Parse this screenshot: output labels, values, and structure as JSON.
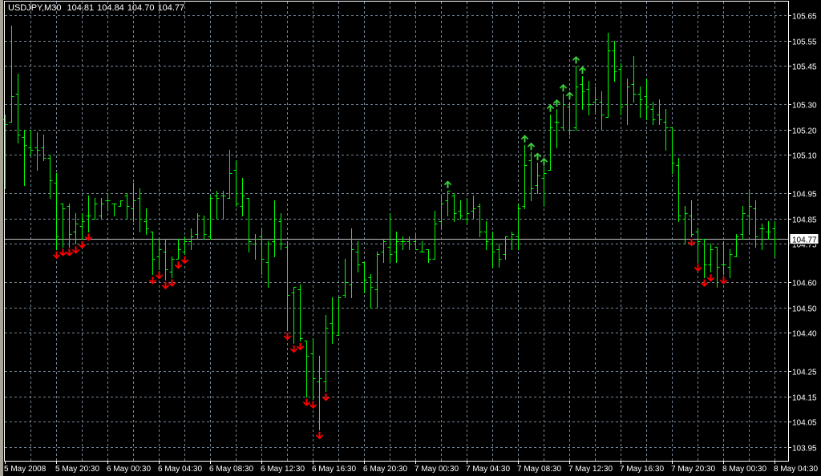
{
  "header": {
    "symbol": "USDJPY,M30",
    "open": "104.81",
    "high": "104.84",
    "low": "104.70",
    "close": "104.77"
  },
  "current_price_label": "104.77",
  "colors": {
    "background": "#000000",
    "bar": "#00ff00",
    "grid": "#778899",
    "down_arrow": "#ff0000",
    "up_arrow": "#3cd03c",
    "price_line": "#c0c0c0"
  },
  "chart_data": {
    "type": "ohlc",
    "title": "USDJPY,M30",
    "timeframe": "M30",
    "ylim": [
      103.95,
      105.65
    ],
    "grid": true,
    "current_price": 104.77,
    "y_ticks": [
      "105.65",
      "105.55",
      "105.45",
      "105.30",
      "105.20",
      "105.10",
      "104.95",
      "104.85",
      "104.75",
      "104.60",
      "104.50",
      "104.40",
      "104.25",
      "104.15",
      "104.05",
      "103.95"
    ],
    "x_tick_labels": [
      {
        "bar": 0,
        "label": "5 May 2008"
      },
      {
        "bar": 8,
        "label": "5 May 20:30"
      },
      {
        "bar": 16,
        "label": "6 May 00:30"
      },
      {
        "bar": 24,
        "label": "6 May 04:30"
      },
      {
        "bar": 32,
        "label": "6 May 08:30"
      },
      {
        "bar": 40,
        "label": "6 May 12:30"
      },
      {
        "bar": 48,
        "label": "6 May 16:30"
      },
      {
        "bar": 56,
        "label": "6 May 20:30"
      },
      {
        "bar": 64,
        "label": "7 May 00:30"
      },
      {
        "bar": 72,
        "label": "7 May 04:30"
      },
      {
        "bar": 80,
        "label": "7 May 08:30"
      },
      {
        "bar": 88,
        "label": "7 May 12:30"
      },
      {
        "bar": 96,
        "label": "7 May 16:30"
      },
      {
        "bar": 104,
        "label": "7 May 20:30"
      },
      {
        "bar": 112,
        "label": "8 May 00:30"
      },
      {
        "bar": 120,
        "label": "8 May 04:30"
      }
    ],
    "ohlc": [
      [
        105.24,
        105.26,
        104.97,
        105.22
      ],
      [
        105.23,
        105.61,
        105.23,
        105.33
      ],
      [
        105.34,
        105.42,
        105.15,
        105.18
      ],
      [
        105.17,
        105.2,
        104.98,
        105.14
      ],
      [
        105.13,
        105.2,
        105.1,
        105.12
      ],
      [
        105.13,
        105.19,
        105.04,
        105.12
      ],
      [
        105.13,
        105.18,
        105.08,
        105.09
      ],
      [
        105.09,
        105.1,
        104.93,
        105.0
      ],
      [
        104.99,
        105.03,
        104.73,
        104.78
      ],
      [
        104.91,
        104.91,
        104.74,
        104.89
      ],
      [
        104.9,
        104.91,
        104.74,
        104.79
      ],
      [
        104.8,
        104.87,
        104.75,
        104.83
      ],
      [
        104.82,
        104.87,
        104.77,
        104.84
      ],
      [
        104.86,
        104.94,
        104.8,
        104.86
      ],
      [
        104.85,
        104.93,
        104.85,
        104.91
      ],
      [
        104.86,
        104.93,
        104.85,
        104.91
      ],
      [
        104.92,
        104.95,
        104.88,
        104.92
      ],
      [
        104.91,
        104.91,
        104.86,
        104.91
      ],
      [
        104.9,
        104.92,
        104.9,
        104.92
      ],
      [
        104.94,
        104.95,
        104.85,
        104.9
      ],
      [
        104.89,
        104.99,
        104.84,
        104.92
      ],
      [
        104.93,
        104.97,
        104.8,
        104.85
      ],
      [
        104.84,
        104.89,
        104.79,
        104.81
      ],
      [
        104.8,
        104.8,
        104.63,
        104.69
      ],
      [
        104.7,
        104.77,
        104.65,
        104.73
      ],
      [
        104.72,
        104.77,
        104.61,
        104.65
      ],
      [
        104.64,
        104.7,
        104.62,
        104.69
      ],
      [
        104.69,
        104.77,
        104.69,
        104.73
      ],
      [
        104.72,
        104.78,
        104.71,
        104.76
      ],
      [
        104.76,
        104.81,
        104.73,
        104.78
      ],
      [
        104.79,
        104.87,
        104.77,
        104.86
      ],
      [
        104.85,
        104.86,
        104.77,
        104.79
      ],
      [
        104.78,
        104.94,
        104.77,
        104.93
      ],
      [
        104.94,
        104.96,
        104.85,
        104.93
      ],
      [
        104.94,
        104.96,
        104.85,
        104.94
      ],
      [
        104.93,
        105.12,
        104.93,
        105.03
      ],
      [
        105.04,
        105.08,
        104.9,
        104.91
      ],
      [
        104.9,
        105.01,
        104.86,
        104.94
      ],
      [
        104.93,
        104.93,
        104.72,
        104.76
      ],
      [
        104.75,
        104.79,
        104.69,
        104.77
      ],
      [
        104.78,
        104.81,
        104.63,
        104.69
      ],
      [
        104.68,
        104.76,
        104.58,
        104.75
      ],
      [
        104.76,
        104.92,
        104.7,
        104.85
      ],
      [
        104.84,
        104.87,
        104.73,
        104.75
      ],
      [
        104.74,
        104.76,
        104.41,
        104.55
      ],
      [
        104.56,
        104.58,
        104.36,
        104.58
      ],
      [
        104.57,
        104.59,
        104.37,
        104.38
      ],
      [
        104.37,
        104.37,
        104.15,
        104.31
      ],
      [
        104.32,
        104.38,
        104.14,
        104.22
      ],
      [
        104.21,
        104.31,
        104.02,
        104.22
      ],
      [
        104.21,
        104.47,
        104.17,
        104.42
      ],
      [
        104.44,
        104.54,
        104.36,
        104.4
      ],
      [
        104.39,
        104.54,
        104.39,
        104.54
      ],
      [
        104.55,
        104.69,
        104.54,
        104.6
      ],
      [
        104.59,
        104.81,
        104.54,
        104.73
      ],
      [
        104.72,
        104.76,
        104.64,
        104.67
      ],
      [
        104.68,
        104.68,
        104.56,
        104.61
      ],
      [
        104.62,
        104.63,
        104.5,
        104.58
      ],
      [
        104.57,
        104.72,
        104.5,
        104.71
      ],
      [
        104.72,
        104.77,
        104.68,
        104.76
      ],
      [
        104.74,
        104.87,
        104.68,
        104.71
      ],
      [
        104.72,
        104.8,
        104.68,
        104.76
      ],
      [
        104.76,
        104.78,
        104.73,
        104.76
      ],
      [
        104.76,
        104.78,
        104.73,
        104.75
      ],
      [
        104.76,
        104.79,
        104.73,
        104.73
      ],
      [
        104.72,
        104.76,
        104.72,
        104.72
      ],
      [
        104.73,
        104.73,
        104.68,
        104.69
      ],
      [
        104.69,
        104.88,
        104.69,
        104.83
      ],
      [
        104.84,
        104.94,
        104.81,
        104.91
      ],
      [
        104.92,
        104.96,
        104.86,
        104.96
      ],
      [
        104.94,
        104.95,
        104.84,
        104.87
      ],
      [
        104.88,
        104.92,
        104.85,
        104.86
      ],
      [
        104.85,
        104.93,
        104.83,
        104.87
      ],
      [
        104.88,
        104.94,
        104.85,
        104.89
      ],
      [
        104.9,
        104.91,
        104.78,
        104.8
      ],
      [
        104.8,
        104.84,
        104.73,
        104.76
      ],
      [
        104.75,
        104.8,
        104.66,
        104.72
      ],
      [
        104.73,
        104.75,
        104.66,
        104.69
      ],
      [
        104.71,
        104.78,
        104.69,
        104.78
      ],
      [
        104.77,
        104.8,
        104.73,
        104.79
      ],
      [
        104.78,
        104.91,
        104.73,
        104.89
      ],
      [
        104.9,
        105.14,
        104.89,
        105.06
      ],
      [
        105.08,
        105.11,
        104.92,
        104.97
      ],
      [
        104.98,
        105.07,
        104.95,
        105.02
      ],
      [
        105.01,
        105.05,
        104.9,
        105.03
      ],
      [
        105.04,
        105.26,
        105.04,
        105.21
      ],
      [
        105.23,
        105.28,
        105.13,
        105.23
      ],
      [
        105.21,
        105.34,
        105.2,
        105.3
      ],
      [
        105.29,
        105.31,
        105.18,
        105.2
      ],
      [
        105.21,
        105.45,
        105.2,
        105.37
      ],
      [
        105.38,
        105.41,
        105.28,
        105.35
      ],
      [
        105.36,
        105.39,
        105.26,
        105.3
      ],
      [
        105.31,
        105.37,
        105.27,
        105.32
      ],
      [
        105.31,
        105.35,
        105.2,
        105.26
      ],
      [
        105.25,
        105.58,
        105.25,
        105.51
      ],
      [
        105.51,
        105.55,
        105.39,
        105.43
      ],
      [
        105.44,
        105.46,
        105.26,
        105.29
      ],
      [
        105.3,
        105.4,
        105.22,
        105.37
      ],
      [
        105.38,
        105.49,
        105.31,
        105.34
      ],
      [
        105.34,
        105.37,
        105.25,
        105.32
      ],
      [
        105.33,
        105.4,
        105.24,
        105.29
      ],
      [
        105.28,
        105.31,
        105.22,
        105.24
      ],
      [
        105.26,
        105.32,
        105.22,
        105.24
      ],
      [
        105.23,
        105.28,
        105.12,
        105.21
      ],
      [
        105.21,
        105.21,
        105.03,
        105.07
      ],
      [
        105.06,
        105.09,
        104.84,
        104.86
      ],
      [
        104.85,
        104.9,
        104.75,
        104.87
      ],
      [
        104.86,
        104.92,
        104.78,
        104.79
      ],
      [
        104.8,
        104.81,
        104.68,
        104.76
      ],
      [
        104.77,
        104.77,
        104.62,
        104.67
      ],
      [
        104.67,
        104.75,
        104.64,
        104.73
      ],
      [
        104.74,
        104.74,
        104.58,
        104.66
      ],
      [
        104.67,
        104.76,
        104.63,
        104.67
      ],
      [
        104.66,
        104.73,
        104.62,
        104.71
      ],
      [
        104.7,
        104.79,
        104.7,
        104.78
      ],
      [
        104.79,
        104.9,
        104.77,
        104.87
      ],
      [
        104.86,
        104.96,
        104.79,
        104.9
      ],
      [
        104.89,
        104.92,
        104.74,
        104.78
      ],
      [
        104.81,
        104.83,
        104.73,
        104.81
      ],
      [
        104.8,
        104.84,
        104.77,
        104.8
      ],
      [
        104.81,
        104.84,
        104.7,
        104.77
      ]
    ],
    "down_arrow_bars": [
      8,
      9,
      10,
      11,
      12,
      13,
      23,
      24,
      25,
      26,
      27,
      28,
      44,
      45,
      46,
      47,
      48,
      49,
      50,
      107,
      108,
      109,
      110,
      112
    ],
    "up_arrow_bars": [
      69,
      81,
      82,
      83,
      84,
      85,
      86,
      87,
      88,
      89,
      90
    ]
  }
}
